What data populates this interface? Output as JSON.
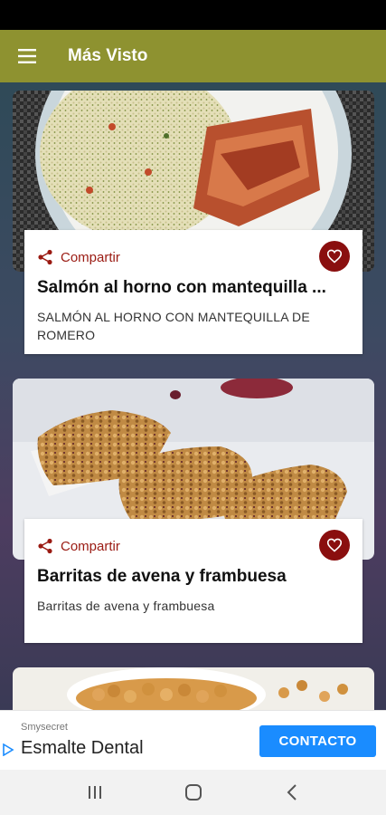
{
  "app_bar": {
    "title": "Más Visto",
    "menu_icon": "hamburger-menu-icon",
    "color": "#8e9230"
  },
  "recipes": [
    {
      "share_label": "Compartir",
      "title": "Salmón al horno con mantequilla ...",
      "description": "SALMÓN AL HORNO CON MANTEQUILLA DE ROMERO",
      "favorite_icon": "heart-icon",
      "image": "salmon-with-rice-plate"
    },
    {
      "share_label": "Compartir",
      "title": "Barritas de avena y frambuesa",
      "description": "Barritas de avena y frambuesa",
      "favorite_icon": "heart-icon",
      "image": "oat-granola-bars"
    },
    {
      "image": "roasted-chickpeas-bowl"
    }
  ],
  "ad": {
    "sponsor": "Smysecret",
    "headline": "Esmalte Dental",
    "cta": "CONTACTO",
    "cta_color": "#1a8cff"
  },
  "nav_bar": {
    "recent_icon": "recent-apps-icon",
    "home_icon": "home-icon",
    "back_icon": "back-icon"
  },
  "colors": {
    "accent": "#8e9230",
    "share_red": "#9a1a12",
    "favorite_red": "#8a0f0f"
  }
}
